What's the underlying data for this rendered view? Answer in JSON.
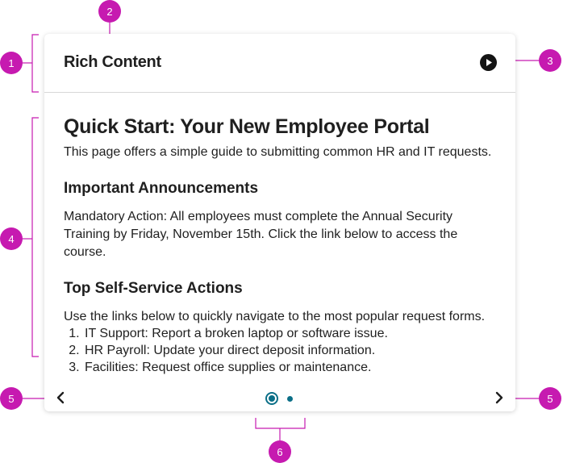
{
  "header": {
    "title": "Rich Content",
    "play_icon": "play-circle-icon"
  },
  "content": {
    "heading": "Quick Start: Your New Employee Portal",
    "intro": "This page offers a simple guide to submitting common HR and IT requests.",
    "section1_heading": "Important Announcements",
    "section1_text": "Mandatory Action: All employees must complete the Annual Security Training by Friday, November 15th. Click the link below to access the course.",
    "section2_heading": "Top Self-Service Actions",
    "section2_text": "Use the links below to quickly navigate to the most popular request forms.",
    "list": [
      "IT Support: Report a broken laptop or software issue.",
      "HR Payroll: Update your direct deposit information.",
      "Facilities: Request office supplies or maintenance."
    ]
  },
  "navigation": {
    "prev_icon": "chevron-left-icon",
    "next_icon": "chevron-right-icon",
    "pages": 2,
    "current_page": 1
  },
  "annotations": {
    "markers": [
      "1",
      "2",
      "3",
      "4",
      "5",
      "5",
      "6"
    ],
    "color": "#c61ab0"
  },
  "colors": {
    "accent": "#0b6f87",
    "annotation": "#c61ab0"
  }
}
